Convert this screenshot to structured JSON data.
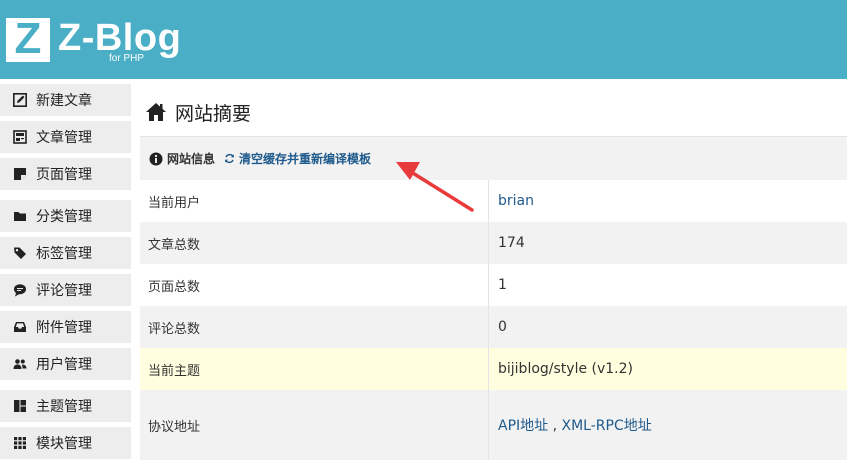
{
  "logo": {
    "mark": "Z",
    "name": "Z-Blog",
    "sub": "for PHP"
  },
  "sidebar": {
    "items": [
      {
        "label": "新建文章",
        "icon": "edit-icon"
      },
      {
        "label": "文章管理",
        "icon": "article-icon"
      },
      {
        "label": "页面管理",
        "icon": "page-icon"
      },
      {
        "label": "分类管理",
        "icon": "folder-icon"
      },
      {
        "label": "标签管理",
        "icon": "tag-icon"
      },
      {
        "label": "评论管理",
        "icon": "comment-icon"
      },
      {
        "label": "附件管理",
        "icon": "inbox-icon"
      },
      {
        "label": "用户管理",
        "icon": "users-icon"
      },
      {
        "label": "主题管理",
        "icon": "layout-icon"
      },
      {
        "label": "模块管理",
        "icon": "grid-icon"
      }
    ]
  },
  "main": {
    "title": "网站摘要",
    "panel": {
      "head_title": "网站信息",
      "refresh_link": "清空缓存并重新编译模板",
      "rows": [
        {
          "label": "当前用户",
          "value": "brian"
        },
        {
          "label": "文章总数",
          "value": "174"
        },
        {
          "label": "页面总数",
          "value": "1"
        },
        {
          "label": "评论总数",
          "value": "0"
        },
        {
          "label": "当前主题",
          "value": "bijiblog/style (v1.2)"
        },
        {
          "label": "协议地址",
          "api_link": "API地址",
          "separator": " , ",
          "xmlrpc_link": "XML-RPC地址"
        }
      ]
    }
  },
  "colors": {
    "header_bg": "#4aaec6",
    "sidebar_item_bg": "#ededed",
    "link": "#1f5a8c",
    "highlight_row": "#ffffe0",
    "annotation_arrow": "#e83a3a"
  }
}
